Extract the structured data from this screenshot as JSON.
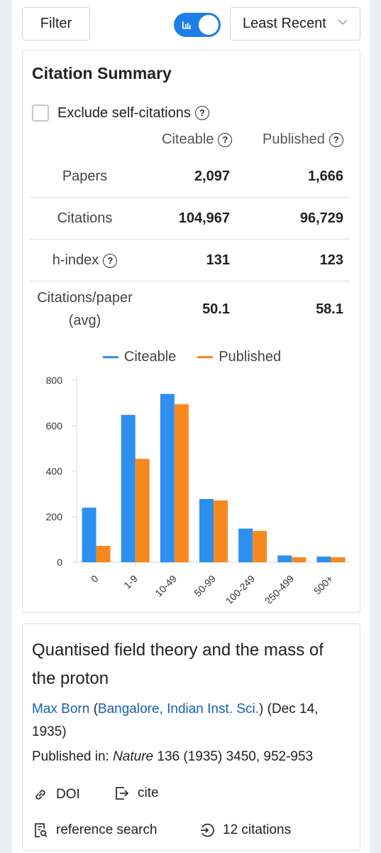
{
  "toolbar": {
    "filter_label": "Filter",
    "chart_toggle_on": true,
    "sort_value": "Least Recent"
  },
  "summary": {
    "title": "Citation Summary",
    "exclude_self_label": "Exclude self-citations",
    "exclude_self_checked": false,
    "col_citeable": "Citeable",
    "col_published": "Published",
    "rows": [
      {
        "label": "Papers",
        "citeable": "2,097",
        "published": "1,666"
      },
      {
        "label": "Citations",
        "citeable": "104,967",
        "published": "96,729"
      },
      {
        "label": "h-index",
        "citeable": "131",
        "published": "123"
      },
      {
        "label": "Citations/paper (avg)",
        "citeable": "50.1",
        "published": "58.1"
      }
    ]
  },
  "chart_data": {
    "type": "bar",
    "categories": [
      "0",
      "1-9",
      "10-49",
      "50-99",
      "100-249",
      "250-499",
      "500+"
    ],
    "series": [
      {
        "name": "Citeable",
        "color": "#2d8ff0",
        "values": [
          240,
          648,
          740,
          278,
          148,
          30,
          25
        ]
      },
      {
        "name": "Published",
        "color": "#f5891e",
        "values": [
          72,
          455,
          695,
          272,
          138,
          22,
          22
        ]
      }
    ],
    "yticks": [
      "800",
      "600",
      "400",
      "200",
      "0"
    ],
    "ylim": [
      0,
      800
    ],
    "legend_position": "top"
  },
  "paper": {
    "title": "Quantised field theory and the mass of the proton",
    "author": "Max Born",
    "affiliation": "Bangalore, Indian Inst. Sci.",
    "date": "(Dec 14, 1935)",
    "published_prefix": "Published in: ",
    "journal": "Nature",
    "pub_details": " 136 (1935) 3450, 952-953",
    "doi_label": "DOI",
    "cite_label": "cite",
    "refsearch_label": "reference search",
    "citations_label": "12 citations"
  },
  "colors": {
    "accent": "#1c7fe6",
    "link": "#1660b8",
    "citeable": "#2d8ff0",
    "published": "#f5891e"
  }
}
